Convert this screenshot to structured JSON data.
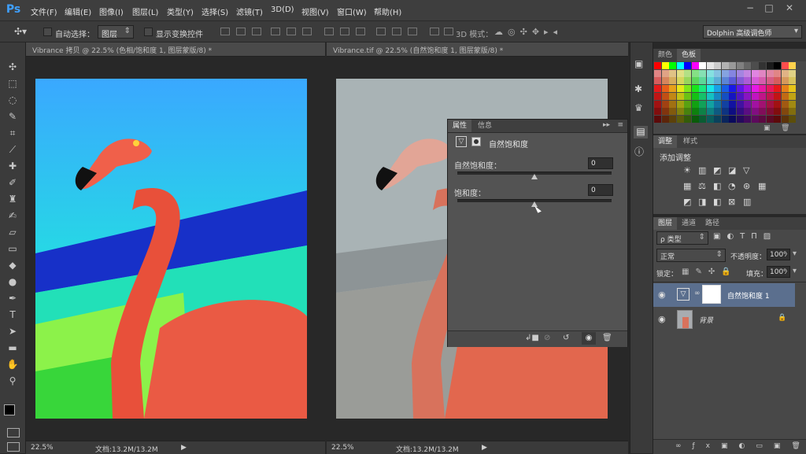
{
  "app": {
    "logo": "Ps"
  },
  "menu": [
    "文件(F)",
    "编辑(E)",
    "图像(I)",
    "图层(L)",
    "类型(Y)",
    "选择(S)",
    "滤镜(T)",
    "3D(D)",
    "视图(V)",
    "窗口(W)",
    "帮助(H)"
  ],
  "window_controls": [
    "−",
    "□",
    "✕"
  ],
  "options": {
    "auto_select_label": "自动选择：",
    "auto_select_value": "图层",
    "show_transform_label": "显示变换控件",
    "mode_3d_label": "3D 模式：",
    "workspace_value": "Dolphin 高级调色师"
  },
  "documents": [
    {
      "tab": "Vibrance 拷贝 @ 22.5% (色相/饱和度 1, 图层蒙版/8) *",
      "zoom": "22.5%",
      "doc_info": "文档:13.2M/13.2M"
    },
    {
      "tab": "Vibrance.tif @ 22.5% (自然饱和度 1, 图层蒙版/8) *",
      "zoom": "22.5%",
      "doc_info": "文档:13.2M/13.2M"
    }
  ],
  "properties": {
    "tabs": [
      "属性",
      "信息"
    ],
    "title": "自然饱和度",
    "vibrance_label": "自然饱和度：",
    "vibrance_value": "0",
    "saturation_label": "饱和度：",
    "saturation_value": "0",
    "vibrance_level": 0.5,
    "saturation_level": 0.5
  },
  "swatches_panel": {
    "tabs": [
      "颜色",
      "色板"
    ]
  },
  "adjustments_panel": {
    "tabs": [
      "调整",
      "样式"
    ],
    "heading": "添加调整"
  },
  "layers_panel": {
    "tabs": [
      "图层",
      "通道",
      "路径"
    ],
    "filter_label": "ρ 类型",
    "blend_mode": "正常",
    "opacity_label": "不透明度：",
    "opacity_value": "100%",
    "lock_label": "锁定：",
    "fill_label": "填充：",
    "fill_value": "100%",
    "layers": [
      {
        "name": "自然饱和度 1",
        "selected": true
      },
      {
        "name": "背景",
        "selected": false
      }
    ]
  },
  "colors": {
    "accent": "#3fa0ff",
    "selected_layer": "#5b6f8e",
    "flamingo": "#e8503a"
  }
}
